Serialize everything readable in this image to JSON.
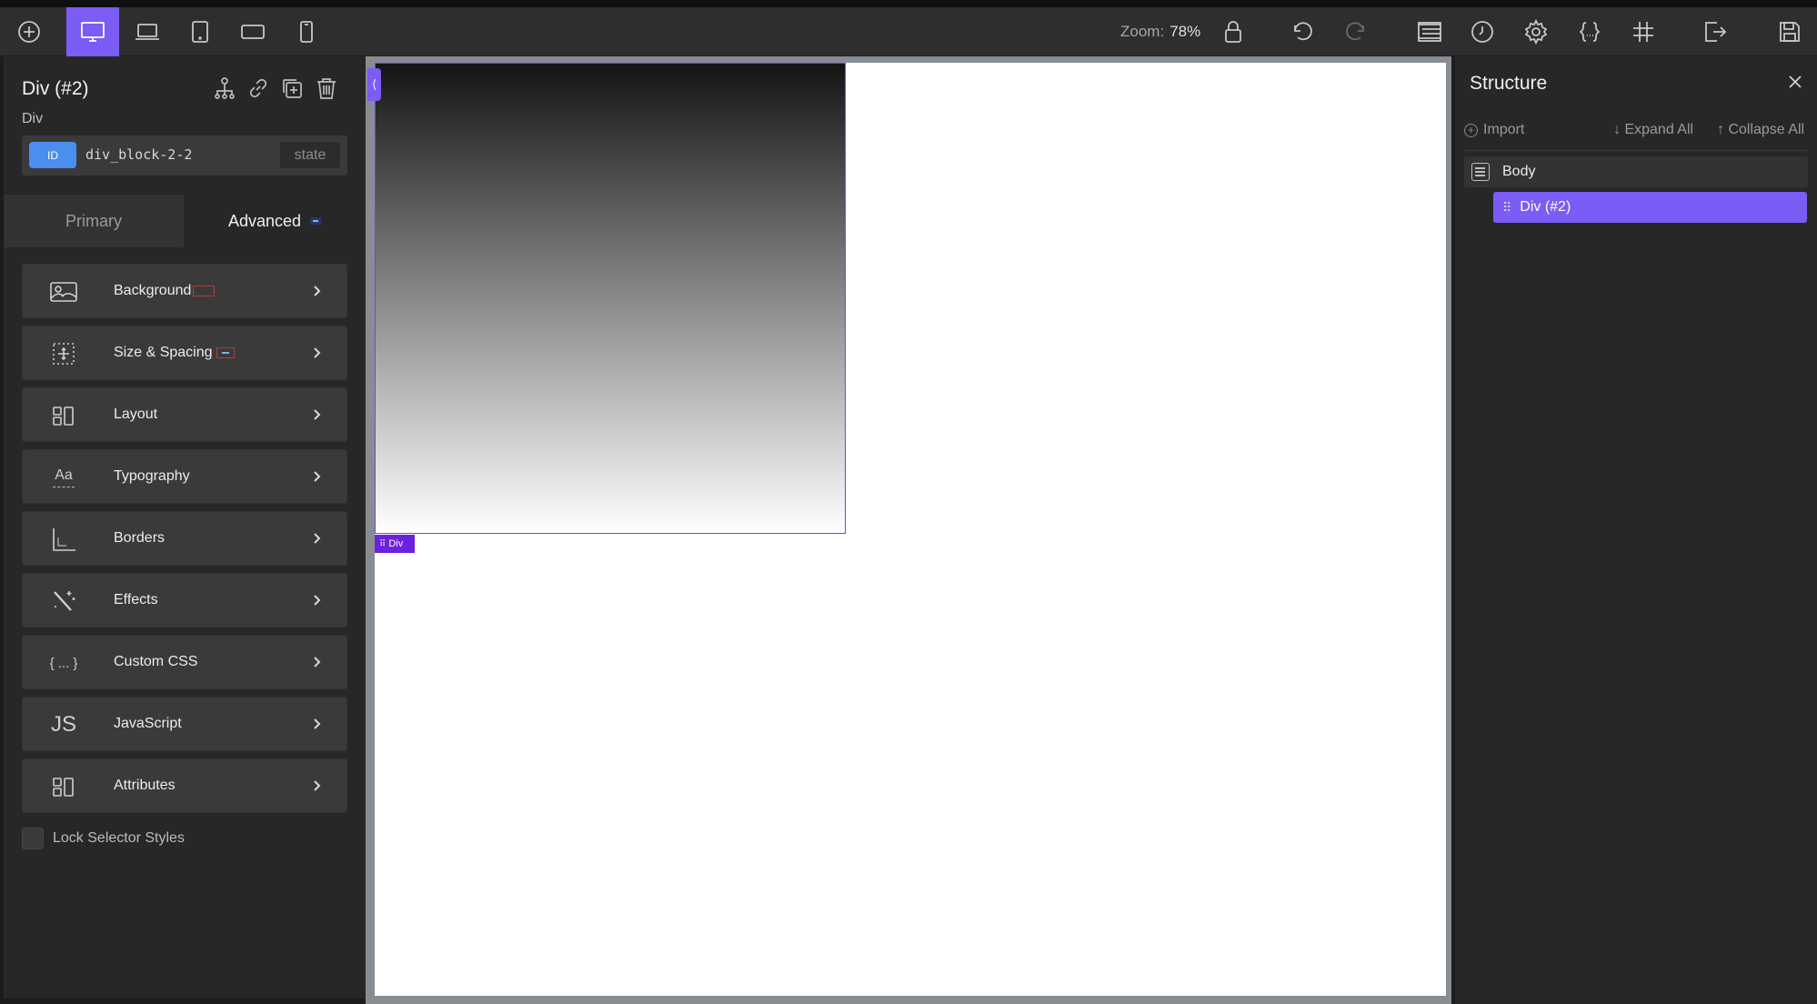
{
  "toolbar": {
    "zoom_label": "Zoom:",
    "zoom_value": "78%",
    "icons": [
      "add-icon",
      "desktop-icon",
      "laptop-icon",
      "tablet-icon",
      "tablet-landscape-icon",
      "mobile-icon",
      "lock-icon",
      "undo-icon",
      "redo-icon",
      "structure-icon",
      "history-icon",
      "settings-icon",
      "code-icon",
      "grid-icon",
      "exit-icon",
      "save-icon"
    ]
  },
  "element": {
    "title": "Div (#2)",
    "type": "Div",
    "id_badge": "ID",
    "selector_value": "div_block-2-2",
    "state_label": "state"
  },
  "tabs": {
    "primary": "Primary",
    "advanced": "Advanced"
  },
  "sections": [
    {
      "label": "Background",
      "icon": "background-icon"
    },
    {
      "label": "Size & Spacing",
      "icon": "size-spacing-icon"
    },
    {
      "label": "Layout",
      "icon": "layout-icon"
    },
    {
      "label": "Typography",
      "icon": "typography-icon",
      "glyph": "Aa"
    },
    {
      "label": "Borders",
      "icon": "borders-icon"
    },
    {
      "label": "Effects",
      "icon": "effects-icon"
    },
    {
      "label": "Custom CSS",
      "icon": "custom-css-icon",
      "glyph": "{ ... }"
    },
    {
      "label": "JavaScript",
      "icon": "javascript-icon",
      "glyph": "JS"
    },
    {
      "label": "Attributes",
      "icon": "attributes-icon"
    }
  ],
  "lock_selector_label": "Lock Selector Styles",
  "canvas": {
    "div_tag_label": "Div"
  },
  "structure": {
    "title": "Structure",
    "import_label": "Import",
    "expand_all": "↓ Expand All",
    "collapse_all": "↑ Collapse All",
    "body_label": "Body",
    "div_label": "Div (#2)"
  },
  "colors": {
    "accent": "#7b5cf5",
    "id_badge": "#4a8ef0",
    "panel": "#272727"
  }
}
